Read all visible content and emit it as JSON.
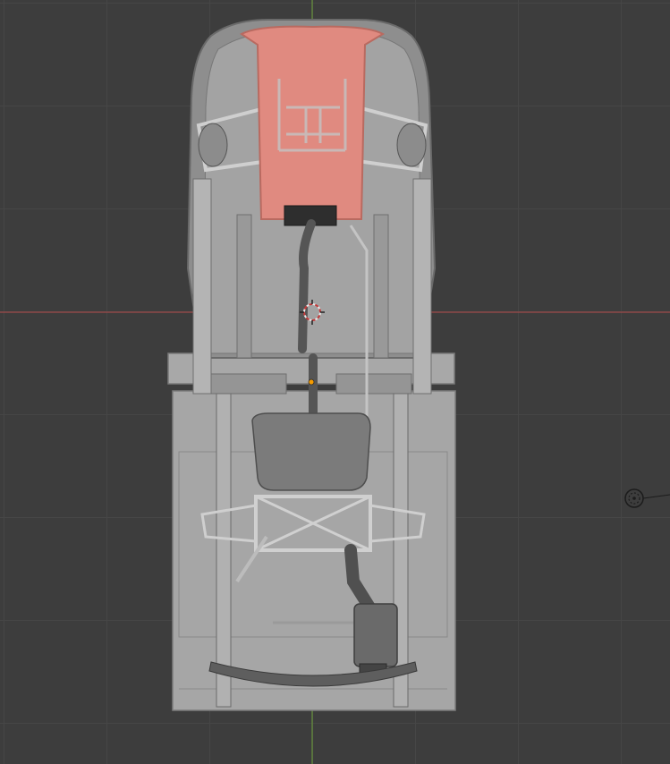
{
  "viewport": {
    "mode": "top-orthographic",
    "grid": true,
    "background_color": "#3d3d3d",
    "grid_color": "#464646",
    "x_axis_color": "#b54a4a",
    "y_axis_color": "#6ea33a"
  },
  "scene": {
    "objects": [
      {
        "name": "chassis-frame",
        "selected": false,
        "color": "#9a9a9a"
      },
      {
        "name": "floor-pan",
        "selected": false,
        "color": "#a6a6a6"
      },
      {
        "name": "engine-cover",
        "selected": true,
        "color": "#e08a80"
      },
      {
        "name": "fuel-tank",
        "selected": false,
        "color": "#7b7b7b"
      },
      {
        "name": "exhaust-system",
        "selected": false,
        "color": "#6d6d6d"
      },
      {
        "name": "front-suspension",
        "selected": false,
        "color": "#b8b8b8"
      },
      {
        "name": "rear-suspension",
        "selected": false,
        "color": "#b8b8b8"
      },
      {
        "name": "muffler",
        "selected": false,
        "color": "#6a6a6a"
      }
    ]
  },
  "gizmos": {
    "cursor_3d": "3d-cursor-icon",
    "origin": "object-origin-icon",
    "light": "light-icon"
  }
}
